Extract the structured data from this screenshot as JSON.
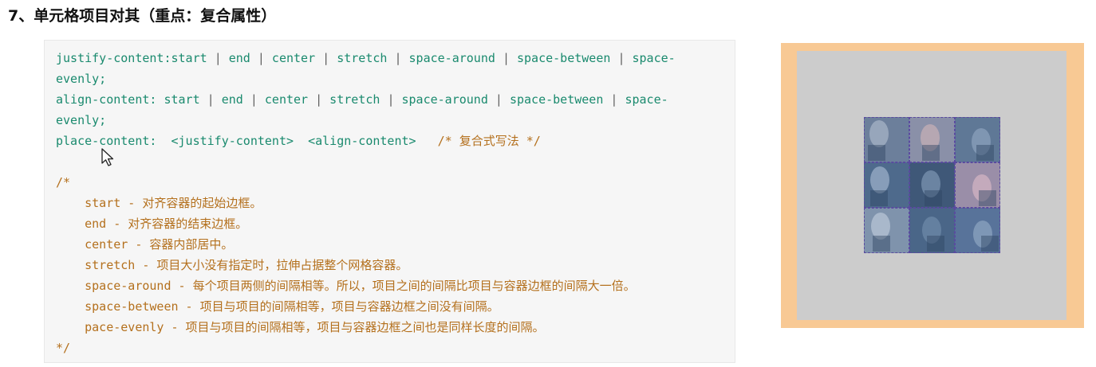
{
  "heading": "7、单元格项目对其（重点：复合属性）",
  "code": {
    "lines": [
      [
        {
          "t": "justify-content:start ",
          "c": "g"
        },
        {
          "t": "|",
          "c": "d"
        },
        {
          "t": " end ",
          "c": "g"
        },
        {
          "t": "|",
          "c": "d"
        },
        {
          "t": " center ",
          "c": "g"
        },
        {
          "t": "|",
          "c": "d"
        },
        {
          "t": " stretch ",
          "c": "g"
        },
        {
          "t": "|",
          "c": "d"
        },
        {
          "t": " space-around ",
          "c": "g"
        },
        {
          "t": "|",
          "c": "d"
        },
        {
          "t": " space-between ",
          "c": "g"
        },
        {
          "t": "|",
          "c": "d"
        },
        {
          "t": " space-",
          "c": "g"
        }
      ],
      [
        {
          "t": "evenly;",
          "c": "g"
        }
      ],
      [
        {
          "t": "align-content: start ",
          "c": "g"
        },
        {
          "t": "|",
          "c": "d"
        },
        {
          "t": " end ",
          "c": "g"
        },
        {
          "t": "|",
          "c": "d"
        },
        {
          "t": " center ",
          "c": "g"
        },
        {
          "t": "|",
          "c": "d"
        },
        {
          "t": " stretch ",
          "c": "g"
        },
        {
          "t": "|",
          "c": "d"
        },
        {
          "t": " space-around ",
          "c": "g"
        },
        {
          "t": "|",
          "c": "d"
        },
        {
          "t": " space-between ",
          "c": "g"
        },
        {
          "t": "|",
          "c": "d"
        },
        {
          "t": " space-",
          "c": "g"
        }
      ],
      [
        {
          "t": "evenly;",
          "c": "g"
        }
      ],
      [
        {
          "t": "place-content:  <justify-content>  <align-content>   ",
          "c": "g"
        },
        {
          "t": "/* 复合式写法 */",
          "c": "o"
        }
      ],
      [
        {
          "t": "",
          "c": "g"
        }
      ],
      [
        {
          "t": "/*",
          "c": "o"
        }
      ],
      [
        {
          "t": "    start - 对齐容器的起始边框。",
          "c": "o"
        }
      ],
      [
        {
          "t": "    end - 对齐容器的结束边框。",
          "c": "o"
        }
      ],
      [
        {
          "t": "    center - 容器内部居中。",
          "c": "o"
        }
      ],
      [
        {
          "t": "    stretch - 项目大小没有指定时，拉伸占据整个网格容器。",
          "c": "o"
        }
      ],
      [
        {
          "t": "    space-around - 每个项目两侧的间隔相等。所以，项目之间的间隔比项目与容器边框的间隔大一倍。",
          "c": "o"
        }
      ],
      [
        {
          "t": "    space-between - 项目与项目的间隔相等，项目与容器边框之间没有间隔。",
          "c": "o"
        }
      ],
      [
        {
          "t": "    pace-evenly - 项目与项目的间隔相等，项目与容器边框之间也是同样长度的间隔。",
          "c": "o"
        }
      ],
      [
        {
          "t": "*/",
          "c": "o"
        }
      ]
    ]
  },
  "colors": {
    "property": "#1a8a6e",
    "separator": "#606060",
    "comment": "#b4701d",
    "demo_border": "#f8c994",
    "demo_background": "#cccccc",
    "cell_outline": "#5a4aa0"
  },
  "cursor_icon": "mouse-pointer-icon",
  "demo": {
    "cells": [
      {
        "icon": "photo-thumbnail-icon",
        "bg": "#6c7f9b",
        "fg": "#a9b7c9"
      },
      {
        "icon": "photo-thumbnail-icon",
        "bg": "#8a90a8",
        "fg": "#c9b0b6"
      },
      {
        "icon": "photo-thumbnail-icon",
        "bg": "#5f7896",
        "fg": "#8da3bd"
      },
      {
        "icon": "photo-thumbnail-icon",
        "bg": "#4e6a8c",
        "fg": "#9fb4cc"
      },
      {
        "icon": "photo-thumbnail-icon",
        "bg": "#3f5878",
        "fg": "#7f97b4"
      },
      {
        "icon": "photo-thumbnail-icon",
        "bg": "#9a8ea8",
        "fg": "#d6b7c4"
      },
      {
        "icon": "photo-thumbnail-icon",
        "bg": "#7f93ac",
        "fg": "#bac8d8"
      },
      {
        "icon": "photo-thumbnail-icon",
        "bg": "#4a6688",
        "fg": "#6f8bab"
      },
      {
        "icon": "photo-thumbnail-icon",
        "bg": "#58739a",
        "fg": "#8fa6c2"
      }
    ]
  }
}
